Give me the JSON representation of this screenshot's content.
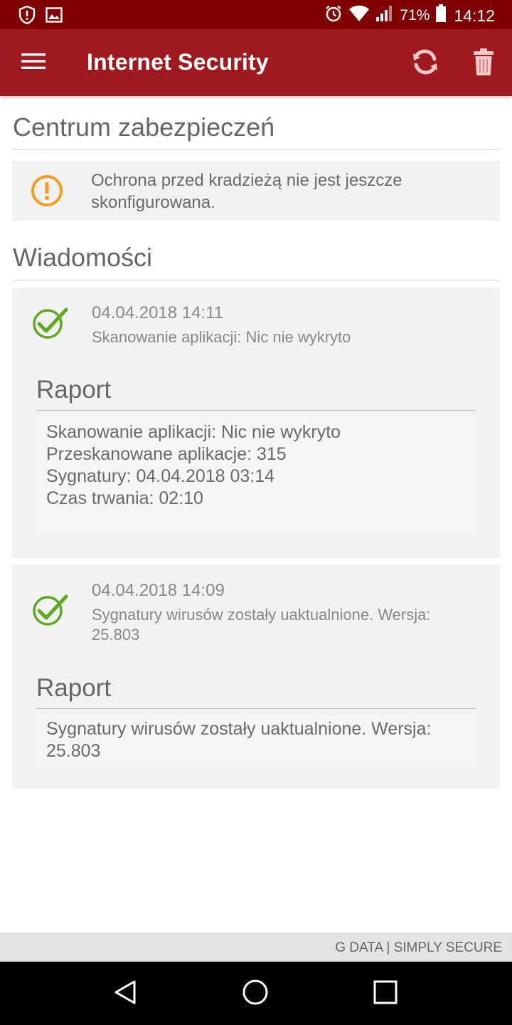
{
  "status_bar": {
    "battery_percent": "71%",
    "time": "14:12"
  },
  "app_bar": {
    "title": "Internet Security"
  },
  "security_center": {
    "title": "Centrum zabezpieczeń",
    "alert_text": "Ochrona przed kradzieżą nie jest jeszcze skonfigurowana."
  },
  "messages": {
    "title": "Wiadomości",
    "items": [
      {
        "date": "04.04.2018 14:11",
        "description": "Skanowanie aplikacji: Nic nie wykryto",
        "report_title": "Raport",
        "report_lines": [
          "Skanowanie aplikacji: Nic nie wykryto",
          "Przeskanowane aplikacje: 315",
          "Sygnatury: 04.04.2018 03:14",
          "Czas trwania: 02:10"
        ]
      },
      {
        "date": "04.04.2018 14:09",
        "description": "Sygnatury wirusów zostały uaktualnione. Wersja: 25.803",
        "report_title": "Raport",
        "report_lines": [
          "Sygnatury wirusów zostały uaktualnione. Wersja: 25.803"
        ]
      }
    ]
  },
  "footer": {
    "text": "G DATA | SIMPLY SECURE"
  },
  "colors": {
    "status_bar": "#7f0000",
    "app_bar": "#9e1a1f",
    "warning": "#f39c1f",
    "success": "#5fa821"
  },
  "icons": {
    "status_left": [
      "shield-icon",
      "image-icon"
    ],
    "status_right": [
      "alarm-icon",
      "wifi-icon",
      "signal-icon",
      "battery-icon"
    ],
    "app_bar": [
      "menu-icon",
      "refresh-icon",
      "trash-icon"
    ],
    "nav": [
      "back-icon",
      "home-icon",
      "recents-icon"
    ]
  }
}
